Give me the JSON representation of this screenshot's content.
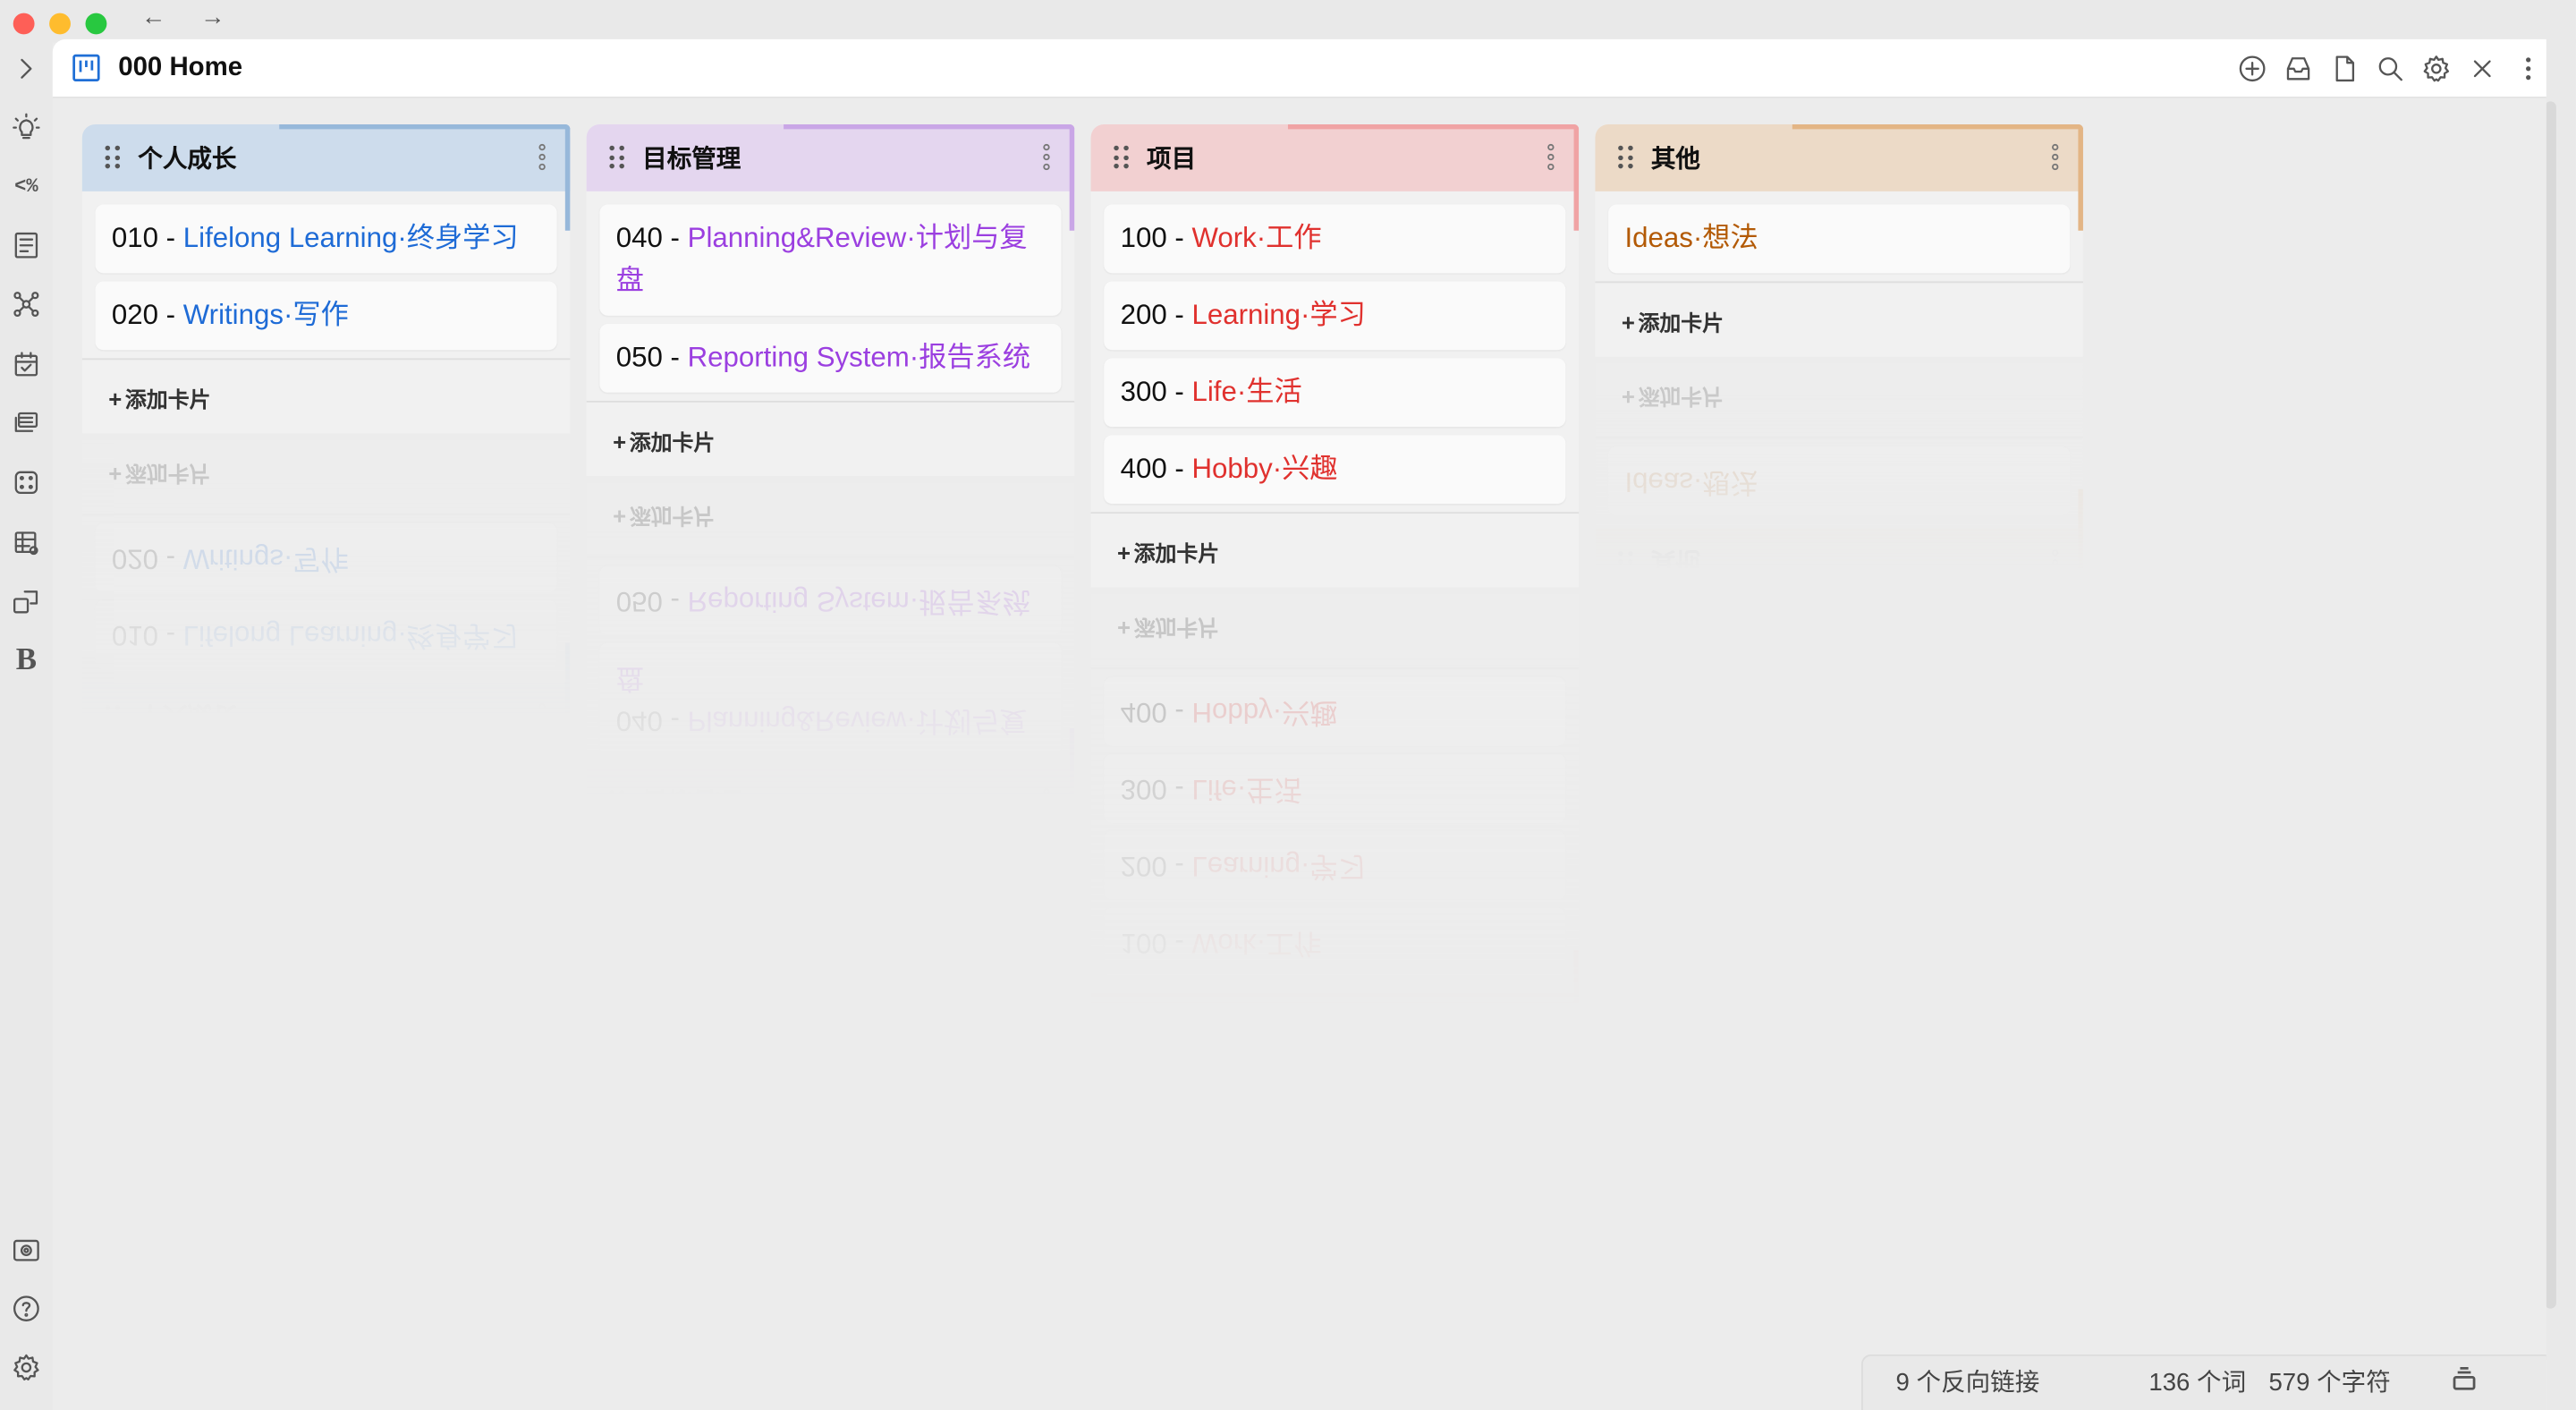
{
  "window": {
    "nav_back": "←",
    "nav_forward": "→"
  },
  "tab": {
    "title": "000 Home"
  },
  "ribbon": {
    "icons": [
      "collapse-sidebar-icon",
      "lightbulb-icon",
      "percent-code-icon",
      "outline-icon",
      "graph-icon",
      "calendar-check-icon",
      "layers-icon",
      "dice-icon",
      "table-gear-icon",
      "shapes-icon",
      "bold-b-icon",
      "vault-icon",
      "help-icon",
      "settings-icon"
    ],
    "code_label": "<%",
    "bold_label": "B"
  },
  "header_actions": [
    "add-icon",
    "archive-icon",
    "file-icon",
    "search-icon",
    "gear-icon",
    "close-icon",
    "more-icon"
  ],
  "lanes": [
    {
      "title": "个人成长",
      "header_bg": "#cddcec",
      "accent": "#97b8da",
      "link_color": "#1e6bd6",
      "cards": [
        {
          "num": "010 - ",
          "link": "Lifelong Learning·终身学习"
        },
        {
          "num": "020 - ",
          "link": "Writings·写作"
        }
      ],
      "add_label": "添加卡片"
    },
    {
      "title": "目标管理",
      "header_bg": "#e4d6ef",
      "accent": "#c9a6e6",
      "link_color": "#9b3fe0",
      "cards": [
        {
          "num": "040 - ",
          "link": "Planning&Review·计划与复盘"
        },
        {
          "num": "050 - ",
          "link": "Reporting System·报告系统"
        }
      ],
      "add_label": "添加卡片"
    },
    {
      "title": "项目",
      "header_bg": "#f2d0d1",
      "accent": "#f0a3a4",
      "link_color": "#e0312e",
      "cards": [
        {
          "num": "100 - ",
          "link": "Work·工作"
        },
        {
          "num": "200 - ",
          "link": "Learning·学习"
        },
        {
          "num": "300 - ",
          "link": "Life·生活"
        },
        {
          "num": "400 - ",
          "link": "Hobby·兴趣"
        }
      ],
      "add_label": "添加卡片"
    },
    {
      "title": "其他",
      "header_bg": "#ecdac7",
      "accent": "#e3b585",
      "link_color": "#b35a06",
      "cards": [
        {
          "num": "",
          "link": "Ideas·想法"
        }
      ],
      "add_label": "添加卡片"
    }
  ],
  "status": {
    "backlinks": "9 个反向链接",
    "words": "136 个词",
    "chars": "579 个字符"
  }
}
